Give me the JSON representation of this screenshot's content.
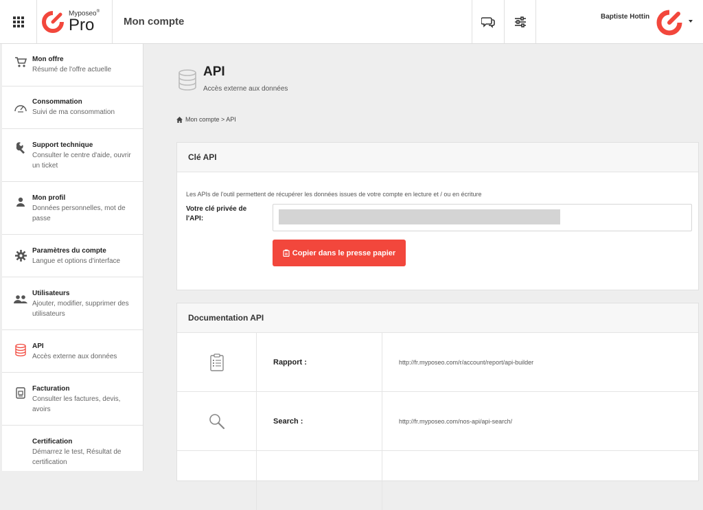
{
  "header": {
    "brand_small": "Myposeo",
    "brand_reg": "®",
    "brand_big": "Pro",
    "page_title": "Mon compte",
    "user_name": "Baptiste Hottin",
    "brand_color": "#f2473c",
    "icons": [
      "apps-grid-icon",
      "chat-icon",
      "sliders-icon",
      "avatar-logo-icon",
      "caret-down-icon"
    ]
  },
  "sidebar": {
    "items": [
      {
        "title": "Mon offre",
        "subtitle": "Résumé de l'offre actuelle",
        "icon": "cart-icon"
      },
      {
        "title": "Consommation",
        "subtitle": "Suivi de ma consommation",
        "icon": "speedometer-icon"
      },
      {
        "title": "Support technique",
        "subtitle": "Consulter le centre d'aide, ouvrir un ticket",
        "icon": "wrench-icon"
      },
      {
        "title": "Mon profil",
        "subtitle": "Données personnelles, mot de passe",
        "icon": "user-icon"
      },
      {
        "title": "Paramètres du compte",
        "subtitle": "Langue et options d'interface",
        "icon": "gear-icon"
      },
      {
        "title": "Utilisateurs",
        "subtitle": "Ajouter, modifier, supprimer des utilisateurs",
        "icon": "users-icon"
      },
      {
        "title": "API",
        "subtitle": "Accès externe aux données",
        "icon": "database-icon",
        "active": true
      },
      {
        "title": "Facturation",
        "subtitle": "Consulter les factures, devis, avoirs",
        "icon": "invoice-icon"
      },
      {
        "title": "Certification",
        "subtitle": "Démarrez le test, Résultat de certification",
        "icon": ""
      }
    ]
  },
  "main": {
    "title": "API",
    "subtitle": "Accès externe aux données",
    "breadcrumb": "Mon compte > API",
    "api_key_panel": {
      "heading": "Clé API",
      "description": "Les APIs de l'outil permettent de récupérer les données issues de votre compte en lecture et / ou en écriture",
      "key_label": "Votre clé privée de l'API:",
      "key_value": "",
      "copy_button": "Copier dans le presse papier"
    },
    "doc_panel": {
      "heading": "Documentation API",
      "rows": [
        {
          "name": "Rapport :",
          "url": "http://fr.myposeo.com/r/account/report/api-builder",
          "icon": "clipboard-icon"
        },
        {
          "name": "Search :",
          "url": "http://fr.myposeo.com/nos-api/api-search/",
          "icon": "magnifier-icon"
        }
      ]
    }
  }
}
